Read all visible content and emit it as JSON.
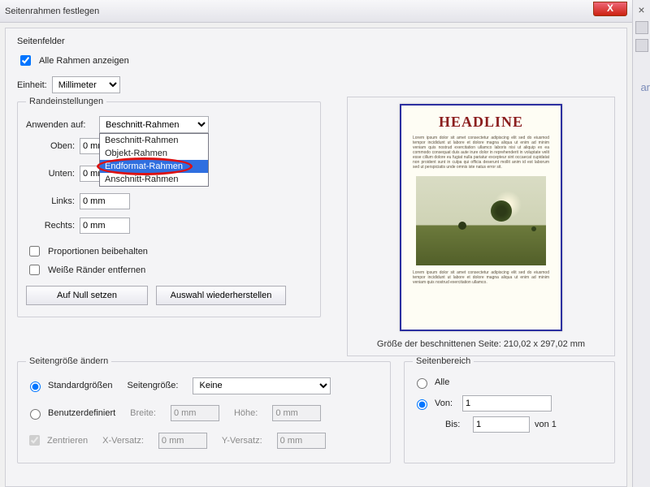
{
  "window": {
    "title": "Seitenrahmen festlegen",
    "close_label": "X"
  },
  "sidefields": {
    "legend": "Seitenfelder",
    "show_all_frames": "Alle Rahmen anzeigen",
    "unit_label": "Einheit:",
    "unit_value": "Millimeter"
  },
  "margins": {
    "legend": "Randeinstellungen",
    "apply_label": "Anwenden auf:",
    "apply_value": "Beschnitt-Rahmen",
    "options": {
      "o0": "Beschnitt-Rahmen",
      "o1": "Objekt-Rahmen",
      "o2": "Endformat-Rahmen",
      "o3": "Anschnitt-Rahmen"
    },
    "top_label": "Oben:",
    "top_value": "0 mm",
    "bottom_label": "Unten:",
    "bottom_value": "0 mm",
    "left_label": "Links:",
    "left_value": "0 mm",
    "right_label": "Rechts:",
    "right_value": "0 mm",
    "keep_prop": "Proportionen beibehalten",
    "remove_white": "Weiße Ränder entfernen",
    "reset_btn": "Auf Null setzen",
    "restore_btn": "Auswahl wiederherstellen"
  },
  "preview": {
    "headline": "HEADLINE",
    "caption": "Größe der beschnittenen Seite: 210,02 x 297,02 mm"
  },
  "pagesize": {
    "legend": "Seitengröße ändern",
    "standard": "Standardgrößen",
    "custom": "Benutzerdefiniert",
    "pagesize_label": "Seitengröße:",
    "pagesize_value": "Keine",
    "width_label": "Breite:",
    "width_value": "0 mm",
    "height_label": "Höhe:",
    "height_value": "0 mm",
    "center": "Zentrieren",
    "xoff_label": "X-Versatz:",
    "xoff_value": "0 mm",
    "yoff_label": "Y-Versatz:",
    "yoff_value": "0 mm"
  },
  "range": {
    "legend": "Seitenbereich",
    "all": "Alle",
    "from_label": "Von:",
    "from_value": "1",
    "to_label": "Bis:",
    "to_value": "1",
    "of_suffix": "von 1"
  },
  "side_hint": "ar"
}
